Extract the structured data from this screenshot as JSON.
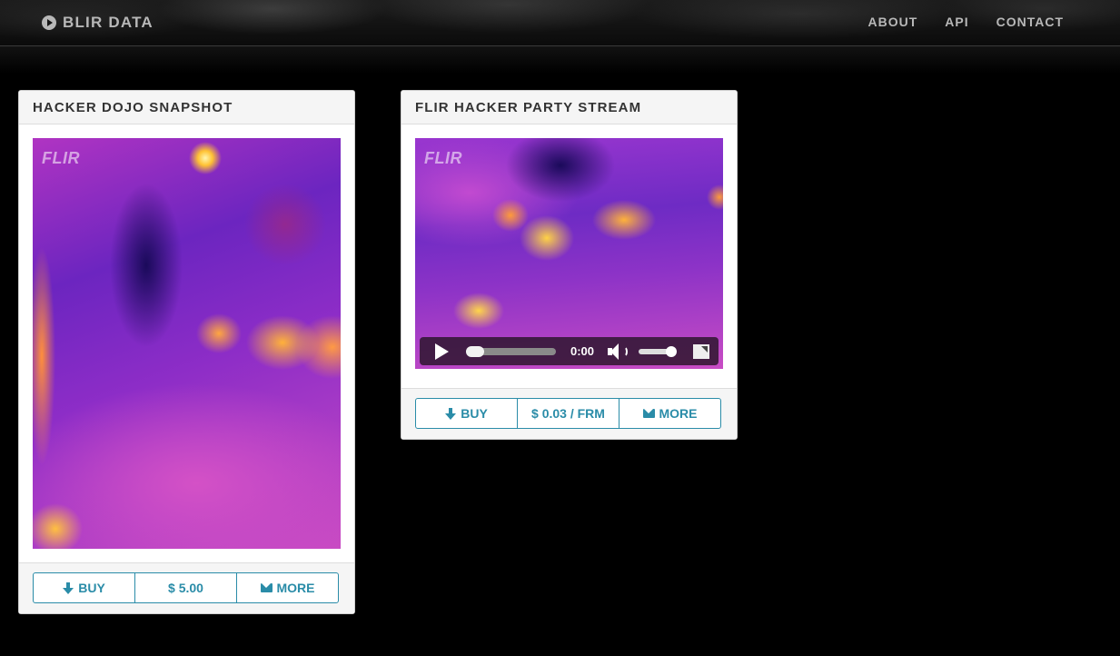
{
  "header": {
    "brand": "BLIR DATA",
    "nav": [
      {
        "label": "ABOUT"
      },
      {
        "label": "API"
      },
      {
        "label": "CONTACT"
      }
    ]
  },
  "cards": [
    {
      "title": "HACKER DOJO SNAPSHOT",
      "image_logo": "FLIR",
      "buttons": {
        "buy": "BUY",
        "price": "$ 5.00",
        "more": "MORE"
      }
    },
    {
      "title": "FLIR HACKER PARTY STREAM",
      "image_logo": "FLIR",
      "video": {
        "time": "0:00",
        "progress": 0.0,
        "volume": 1.0
      },
      "buttons": {
        "buy": "BUY",
        "price": "$ 0.03 / FRM",
        "more": "MORE"
      }
    }
  ],
  "colors": {
    "accent": "#2a8ca8",
    "background": "#000000",
    "nav_text": "#b8b8b8"
  },
  "icons": [
    "play-circle-icon",
    "arrow-down-icon",
    "envelope-icon",
    "play-icon",
    "volume-icon",
    "fullscreen-icon"
  ]
}
